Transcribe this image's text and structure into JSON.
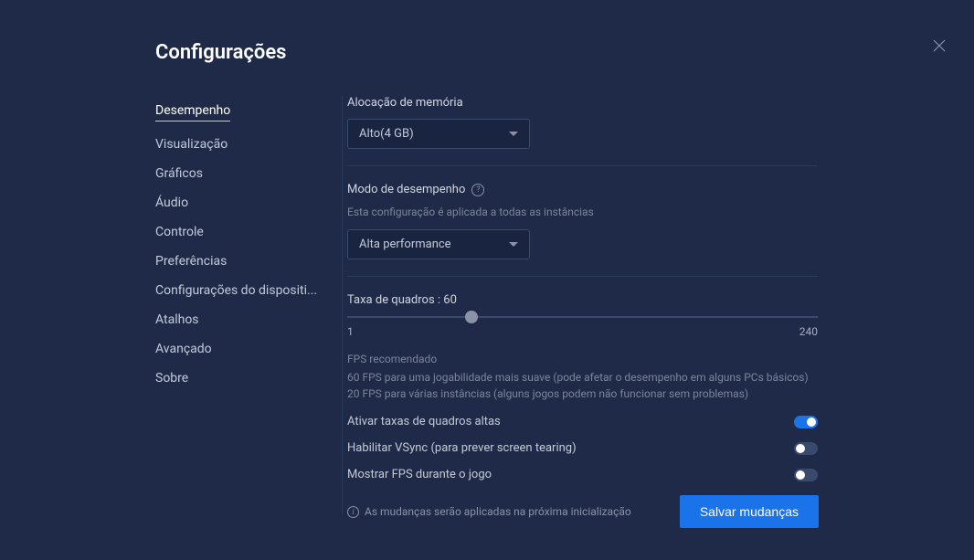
{
  "title": "Configurações",
  "sidebar": {
    "items": [
      {
        "label": "Desempenho",
        "active": true
      },
      {
        "label": "Visualização",
        "active": false
      },
      {
        "label": "Gráficos",
        "active": false
      },
      {
        "label": "Áudio",
        "active": false
      },
      {
        "label": "Controle",
        "active": false
      },
      {
        "label": "Preferências",
        "active": false
      },
      {
        "label": "Configurações do dispositi...",
        "active": false
      },
      {
        "label": "Atalhos",
        "active": false
      },
      {
        "label": "Avançado",
        "active": false
      },
      {
        "label": "Sobre",
        "active": false
      }
    ]
  },
  "memory": {
    "label": "Alocação de memória",
    "value": "Alto(4 GB)"
  },
  "performance_mode": {
    "label": "Modo de desempenho",
    "sublabel": "Esta configuração é aplicada a todas as instâncias",
    "value": "Alta performance"
  },
  "framerate": {
    "label": "Taxa de quadros : 60",
    "min": "1",
    "max": "240",
    "info_title": "FPS recomendado",
    "info_text": "60 FPS para uma jogabilidade mais suave (pode afetar o desempenho em alguns PCs básicos) 20 FPS para várias instâncias (alguns jogos podem não funcionar sem problemas)"
  },
  "toggles": {
    "high_fps": {
      "label": "Ativar taxas de quadros altas",
      "on": true
    },
    "vsync": {
      "label": "Habilitar VSync (para prever screen tearing)",
      "on": false
    },
    "show_fps": {
      "label": "Mostrar FPS durante o jogo",
      "on": false
    }
  },
  "footer": {
    "notice": "As mudanças serão aplicadas na próxima inicialização",
    "save": "Salvar mudanças"
  }
}
